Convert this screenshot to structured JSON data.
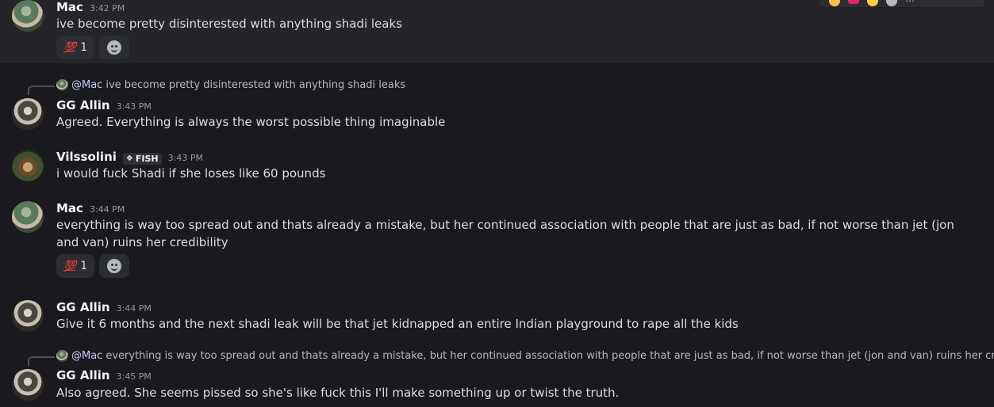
{
  "messages": [
    {
      "id": "m1",
      "author": "Mac",
      "time": "3:42 PM",
      "text": "ive become pretty disinterested with anything shadi leaks",
      "reaction": {
        "emoji": "💯",
        "count": "1"
      }
    },
    {
      "id": "m2",
      "reply_mention": "@Mac",
      "reply_text": "ive become pretty disinterested with anything shadi leaks",
      "author": "GG Allin",
      "time": "3:43 PM",
      "text": "Agreed. Everything is always the worst possible thing imaginable"
    },
    {
      "id": "m3",
      "author": "Vilssolini",
      "tag": "FISH",
      "time": "3:43 PM",
      "text": "i would fuck Shadi if she loses like 60 pounds"
    },
    {
      "id": "m4",
      "author": "Mac",
      "time": "3:44 PM",
      "text": "everything is way too spread out and thats already a mistake, but her continued association with people that are just as bad, if not worse than jet (jon and van) ruins her credibility",
      "reaction": {
        "emoji": "💯",
        "count": "1"
      }
    },
    {
      "id": "m5",
      "author": "GG Allin",
      "time": "3:44 PM",
      "text": "Give it 6 months and the next shadi leak will be that jet kidnapped an entire Indian playground to rape all the kids"
    },
    {
      "id": "m6",
      "reply_mention": "@Mac",
      "reply_text": "everything is way too spread out and thats already a mistake, but her continued association with people that are just as bad, if not worse than jet (jon and van) ruins her credibility",
      "author": "GG Allin",
      "time": "3:45 PM",
      "text": "Also agreed. She seems pissed so she's like fuck this I'll make something up or twist the truth."
    }
  ],
  "colors": {
    "background": "#1a1a1e",
    "hover_background": "#242429",
    "username": "#f2f3f5",
    "timestamp": "#949ba4",
    "mention": "#c9cdfb"
  }
}
